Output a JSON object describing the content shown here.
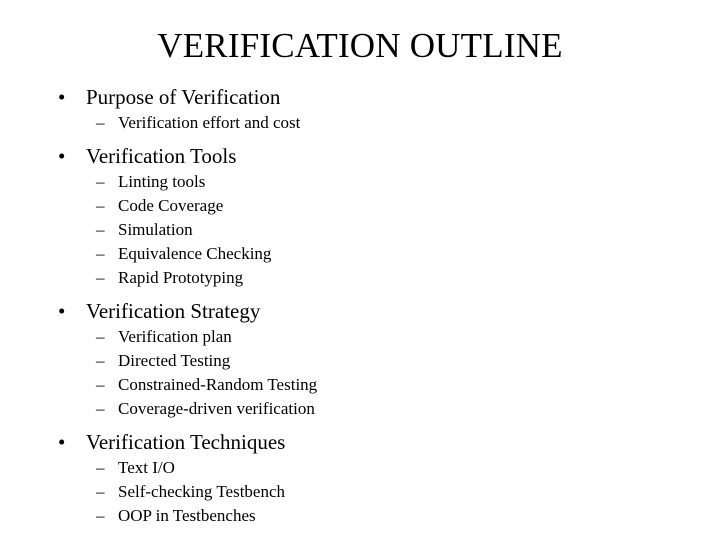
{
  "slide": {
    "title": "VERIFICATION OUTLINE",
    "background_color": "#ffffff",
    "text_color": "#000000",
    "bullet_glyph_level1": "•",
    "bullet_glyph_level2": "–",
    "sections": [
      {
        "heading": "Purpose of Verification",
        "items": [
          "Verification effort and cost"
        ]
      },
      {
        "heading": "Verification Tools",
        "items": [
          "Linting tools",
          "Code Coverage",
          "Simulation",
          "Equivalence Checking",
          "Rapid Prototyping"
        ]
      },
      {
        "heading": "Verification Strategy",
        "items": [
          "Verification plan",
          "Directed Testing",
          "Constrained-Random Testing",
          "Coverage-driven verification"
        ]
      },
      {
        "heading": "Verification Techniques",
        "items": [
          "Text I/O",
          "Self-checking Testbench",
          "OOP in Testbenches"
        ]
      }
    ]
  }
}
